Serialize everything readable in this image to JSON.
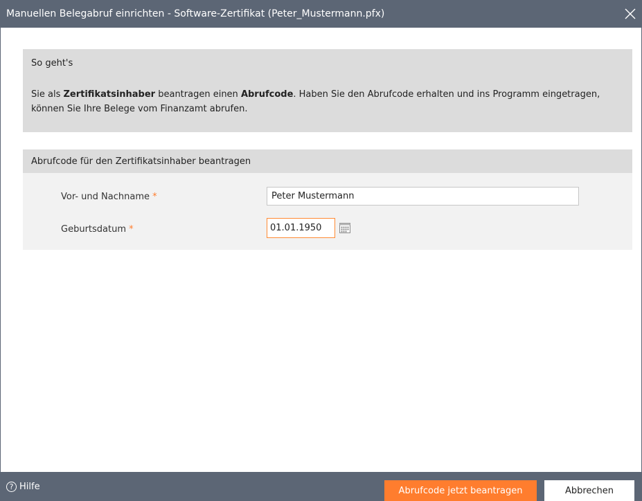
{
  "window": {
    "title": "Manuellen Belegabruf einrichten - Software-Zertifikat (Peter_Mustermann.pfx)",
    "close_icon": "close-icon"
  },
  "info": {
    "title": "So geht's",
    "text_1": "Sie als ",
    "bold_1": "Zertifikatsinhaber",
    "text_2": " beantragen einen ",
    "bold_2": "Abrufcode",
    "text_3": ". Haben Sie den Abrufcode erhalten und ins Programm eingetragen, können Sie Ihre Belege vom Finanzamt abrufen."
  },
  "section": {
    "title": "Abrufcode für den Zertifikatsinhaber beantragen"
  },
  "form": {
    "name_label": "Vor- und Nachname",
    "name_value": "Peter Mustermann",
    "birth_label": "Geburtsdatum",
    "birth_value": "01.01.1950",
    "required_mark": "*",
    "calendar_icon": "calendar-icon"
  },
  "footer": {
    "help_icon_glyph": "?",
    "help_label": "Hilfe",
    "primary_button": "Abrufcode jetzt beantragen",
    "cancel_button": "Abbrechen"
  },
  "colors": {
    "titlebar": "#5c6675",
    "accent": "#ff7d2e",
    "panel": "#dcdcdc",
    "form_bg": "#f2f2f2"
  }
}
